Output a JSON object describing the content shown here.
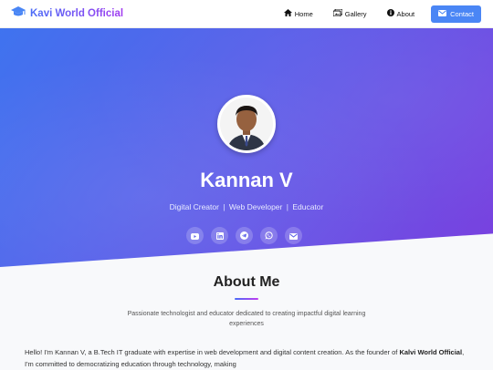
{
  "nav": {
    "brand": "Kavi World Official",
    "items": [
      {
        "label": "Home",
        "icon": "home-icon"
      },
      {
        "label": "Gallery",
        "icon": "gallery-icon"
      },
      {
        "label": "About",
        "icon": "info-icon"
      }
    ],
    "contact_label": "Contact"
  },
  "hero": {
    "name": "Kannan V",
    "tags": [
      "Digital Creator",
      "Web Developer",
      "Educator"
    ],
    "tag_separator": "|",
    "socials": [
      "youtube-icon",
      "linkedin-icon",
      "telegram-icon",
      "whatsapp-icon",
      "email-icon"
    ]
  },
  "about": {
    "title": "About Me",
    "subtitle": "Passionate technologist and educator dedicated to creating impactful digital learning experiences",
    "body_part1": "Hello! I'm Kannan V, a B.Tech IT graduate with expertise in web development and digital content creation. As the founder of ",
    "body_bold": "Kalvi World Official",
    "body_part2": ", I'm committed to democratizing education through technology, making"
  },
  "colors": {
    "accent": "#4a86f5",
    "hero_start": "#3f73ef",
    "hero_end": "#7a40df"
  }
}
